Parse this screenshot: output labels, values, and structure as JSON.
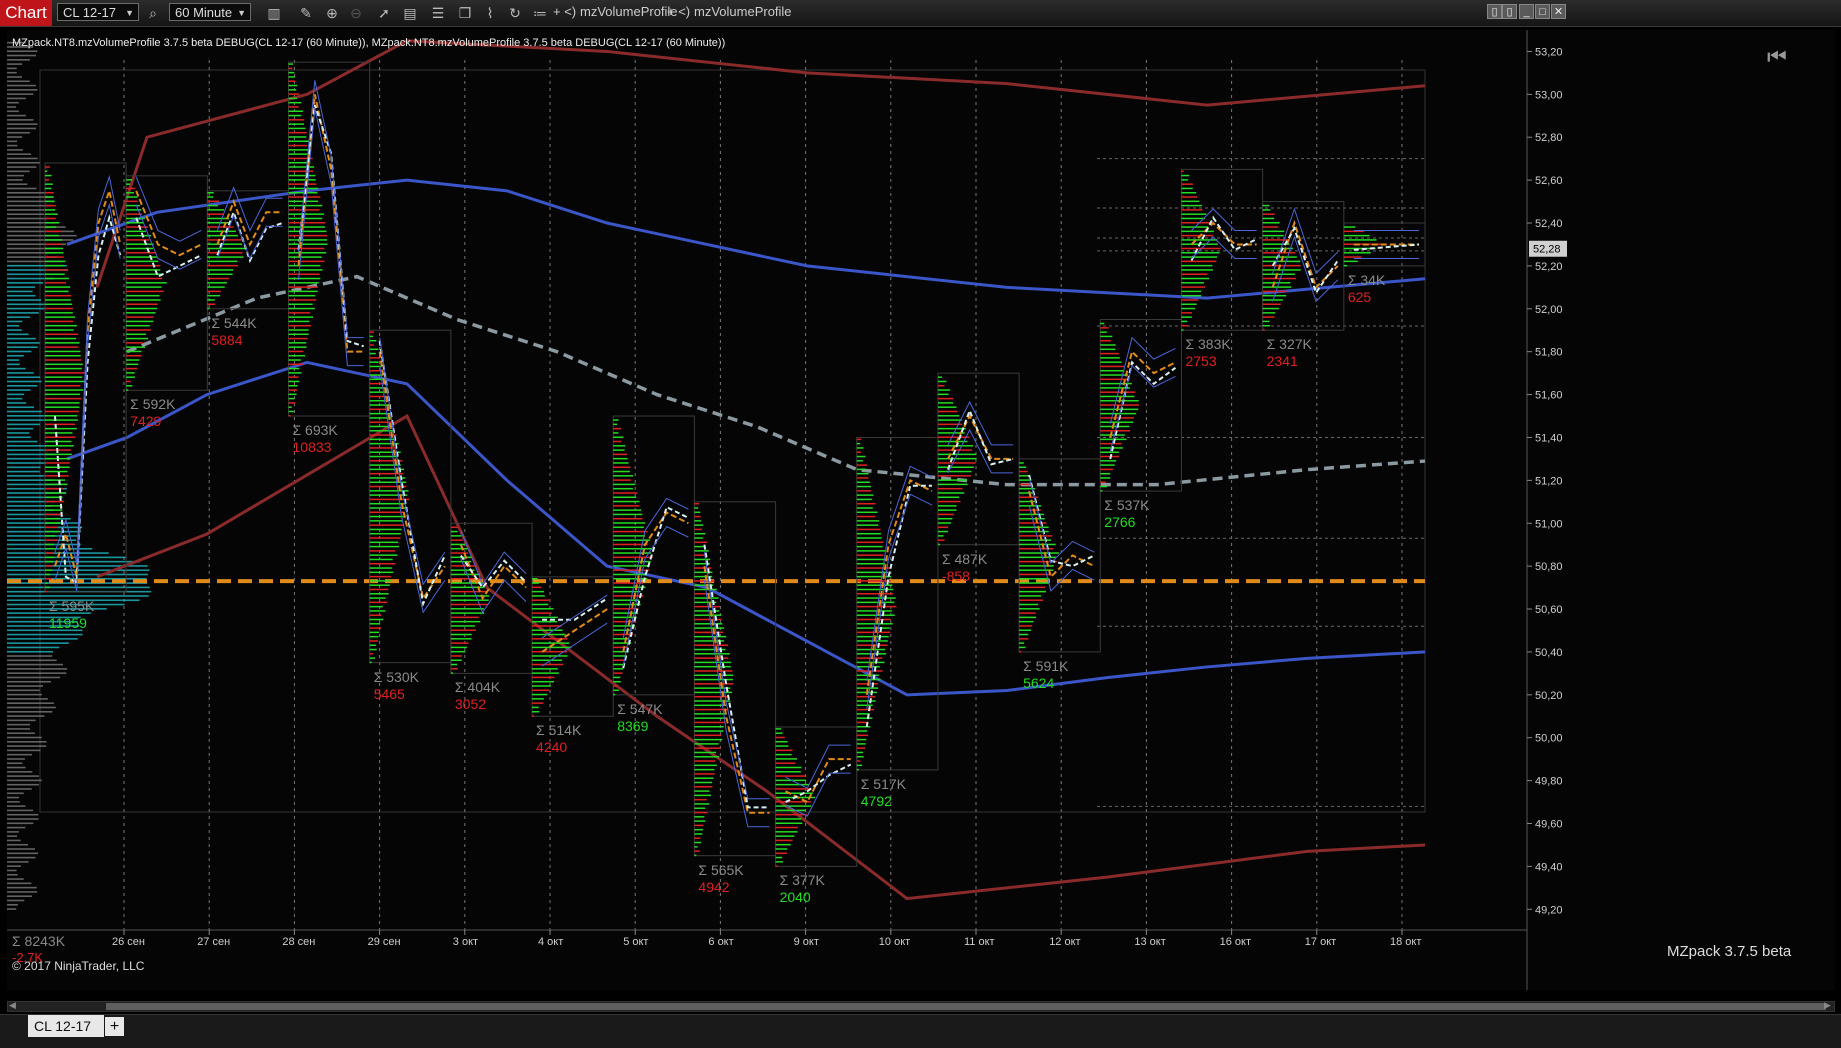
{
  "toolbar": {
    "tab_label": "Chart",
    "instrument": "CL 12-17",
    "interval": "60 Minute",
    "indicator_1": "mzVolumeProfile",
    "indicator_2": "mzVolumeProfile",
    "nav_prefix_1": "+ <)",
    "nav_prefix_2": "+ <)"
  },
  "indicator_label": "MZpack.NT8.mzVolumeProfile 3.7.5 beta DEBUG(CL 12-17 (60 Minute)), MZpack.NT8.mzVolumeProfile 3.7.5 beta DEBUG(CL 12-17 (60 Minute))",
  "copyright": "© 2017 NinjaTrader, LLC",
  "brand": "MZpack 3.7.5 beta",
  "volume_total": {
    "sum": "Σ 8243K",
    "delta": "-2.7K"
  },
  "bottom": {
    "instrument_tab": "CL 12-17",
    "add_tab": "+"
  },
  "colors": {
    "bull": "#22dd22",
    "bear": "#e02020",
    "poc_line": "#e08a1a",
    "vwap_band": "#8a2a2a",
    "vwap": "#3a56c8",
    "profile": "#1fb0b8",
    "grid": "#777777",
    "price_marker": "#cccccc"
  },
  "icons": [
    "search-icon",
    "bars-type-icon",
    "pencil-icon",
    "zoom-in-icon",
    "zoom-out-icon",
    "pointer-icon",
    "data-box-icon",
    "chart-properties-icon",
    "templates-icon",
    "drawing-tools-icon",
    "refresh-icon",
    "indicators-list-icon",
    "minimize-icon",
    "restore-icon",
    "close-icon"
  ],
  "chart_data": {
    "type": "candlestick-volume-profile",
    "y_axis": {
      "range": [
        49.15,
        53.3
      ],
      "ticks": [
        "53,20",
        "53,00",
        "52,80",
        "52,60",
        "52,40",
        "52,20",
        "52,00",
        "51,80",
        "51,60",
        "51,40",
        "51,20",
        "51,00",
        "50,80",
        "50,60",
        "50,40",
        "50,20",
        "50,00",
        "49,80",
        "49,60",
        "49,40",
        "49,20"
      ],
      "current_price": "52,28",
      "current_value": 52.28
    },
    "x_axis": {
      "labels": [
        "26 сен",
        "27 сен",
        "28 сен",
        "29 сен",
        "3 окт",
        "4 окт",
        "5 окт",
        "6 окт",
        "9 окт",
        "10 окт",
        "11 окт",
        "12 окт",
        "13 окт",
        "16 окт",
        "17 окт",
        "18 окт"
      ]
    },
    "poc_level": 50.73,
    "sessions": [
      {
        "sum": "Σ 595K",
        "delta": "11959",
        "delta_sign": "pos",
        "hi": 52.68,
        "lo": 50.68,
        "path": [
          [
            52.2,
            50.8
          ],
          [
            50.55,
            50.95
          ],
          [
            50.7,
            50.75
          ],
          [
            51.6,
            51.9
          ],
          [
            52.1,
            52.4
          ],
          [
            52.3,
            52.55
          ],
          [
            52.2,
            52.3
          ]
        ]
      },
      {
        "sum": "Σ 592K",
        "delta": "7429",
        "delta_sign": "neg",
        "hi": 52.62,
        "lo": 51.62,
        "path": [
          [
            52.3,
            52.55
          ],
          [
            52.0,
            52.3
          ],
          [
            52.15,
            52.25
          ],
          [
            52.2,
            52.3
          ]
        ]
      },
      {
        "sum": "Σ 544K",
        "delta": "5884",
        "delta_sign": "neg",
        "hi": 52.55,
        "lo": 52.0,
        "path": [
          [
            52.2,
            52.3
          ],
          [
            52.4,
            52.5
          ],
          [
            52.15,
            52.3
          ],
          [
            52.3,
            52.45
          ],
          [
            52.35,
            52.45
          ]
        ]
      },
      {
        "sum": "Σ 693K",
        "delta": "10833",
        "delta_sign": "neg",
        "hi": 53.15,
        "lo": 51.5,
        "path": [
          [
            52.35,
            52.2
          ],
          [
            52.9,
            53.0
          ],
          [
            52.8,
            52.65
          ],
          [
            51.9,
            51.8
          ],
          [
            51.85,
            51.8
          ]
        ]
      },
      {
        "sum": "Σ 530K",
        "delta": "5465",
        "delta_sign": "neg",
        "hi": 51.9,
        "lo": 50.35,
        "path": [
          [
            51.9,
            51.8
          ],
          [
            51.3,
            51.1
          ],
          [
            50.6,
            50.65
          ],
          [
            50.9,
            50.8
          ]
        ]
      },
      {
        "sum": "Σ 404K",
        "delta": "3052",
        "delta_sign": "neg",
        "hi": 51.0,
        "lo": 50.3,
        "path": [
          [
            50.8,
            50.9
          ],
          [
            50.75,
            50.65
          ],
          [
            50.85,
            50.8
          ],
          [
            50.75,
            50.7
          ]
        ]
      },
      {
        "sum": "Σ 514K",
        "delta": "4240",
        "delta_sign": "neg",
        "hi": 50.75,
        "lo": 50.1,
        "path": [
          [
            50.7,
            50.4
          ],
          [
            50.6,
            50.5
          ],
          [
            50.7,
            50.6
          ]
        ]
      },
      {
        "sum": "Σ 547K",
        "delta": "8369",
        "delta_sign": "pos",
        "hi": 51.5,
        "lo": 50.2,
        "path": [
          [
            50.25,
            50.4
          ],
          [
            50.6,
            50.9
          ],
          [
            51.1,
            51.05
          ],
          [
            51.05,
            51.0
          ]
        ]
      },
      {
        "sum": "Σ 565K",
        "delta": "4942",
        "delta_sign": "neg",
        "hi": 51.1,
        "lo": 49.45,
        "path": [
          [
            51.0,
            50.8
          ],
          [
            50.4,
            50.1
          ],
          [
            49.7,
            49.65
          ],
          [
            49.7,
            49.65
          ]
        ]
      },
      {
        "sum": "Σ 377K",
        "delta": "2040",
        "delta_sign": "pos",
        "hi": 50.05,
        "lo": 49.4,
        "path": [
          [
            49.65,
            49.75
          ],
          [
            49.8,
            49.7
          ],
          [
            49.75,
            49.9
          ],
          [
            49.85,
            49.9
          ]
        ]
      },
      {
        "sum": "Σ 517K",
        "delta": "4792",
        "delta_sign": "pos",
        "hi": 51.4,
        "lo": 49.85,
        "path": [
          [
            49.9,
            50.2
          ],
          [
            50.6,
            50.9
          ],
          [
            51.15,
            51.2
          ],
          [
            51.2,
            51.15
          ]
        ]
      },
      {
        "sum": "Σ 487K",
        "delta": "-858",
        "delta_sign": "neg",
        "hi": 51.7,
        "lo": 50.9,
        "path": [
          [
            51.2,
            51.3
          ],
          [
            51.55,
            51.5
          ],
          [
            51.25,
            51.3
          ],
          [
            51.3,
            51.3
          ]
        ]
      },
      {
        "sum": "Σ 591K",
        "delta": "5624",
        "delta_sign": "pos",
        "hi": 51.3,
        "lo": 50.4,
        "path": [
          [
            51.3,
            51.15
          ],
          [
            50.9,
            50.75
          ],
          [
            50.75,
            50.85
          ],
          [
            50.9,
            50.8
          ]
        ]
      },
      {
        "sum": "Σ 537K",
        "delta": "2766",
        "delta_sign": "pos",
        "hi": 51.95,
        "lo": 51.15,
        "path": [
          [
            51.2,
            51.4
          ],
          [
            51.7,
            51.8
          ],
          [
            51.6,
            51.7
          ],
          [
            51.7,
            51.75
          ]
        ]
      },
      {
        "sum": "Σ 383K",
        "delta": "2753",
        "delta_sign": "neg",
        "hi": 52.65,
        "lo": 51.9,
        "path": [
          [
            52.15,
            52.3
          ],
          [
            52.45,
            52.4
          ],
          [
            52.25,
            52.3
          ],
          [
            52.35,
            52.3
          ]
        ]
      },
      {
        "sum": "Σ 327K",
        "delta": "2341",
        "delta_sign": "neg",
        "hi": 52.5,
        "lo": 51.9,
        "path": [
          [
            52.3,
            52.1
          ],
          [
            52.35,
            52.4
          ],
          [
            52.05,
            52.1
          ],
          [
            52.25,
            52.2
          ]
        ]
      },
      {
        "sum": "Σ 34K",
        "delta": "625",
        "delta_sign": "neg",
        "hi": 52.4,
        "lo": 52.2,
        "path": [
          [
            52.25,
            52.3
          ],
          [
            52.3,
            52.3
          ]
        ]
      }
    ]
  }
}
